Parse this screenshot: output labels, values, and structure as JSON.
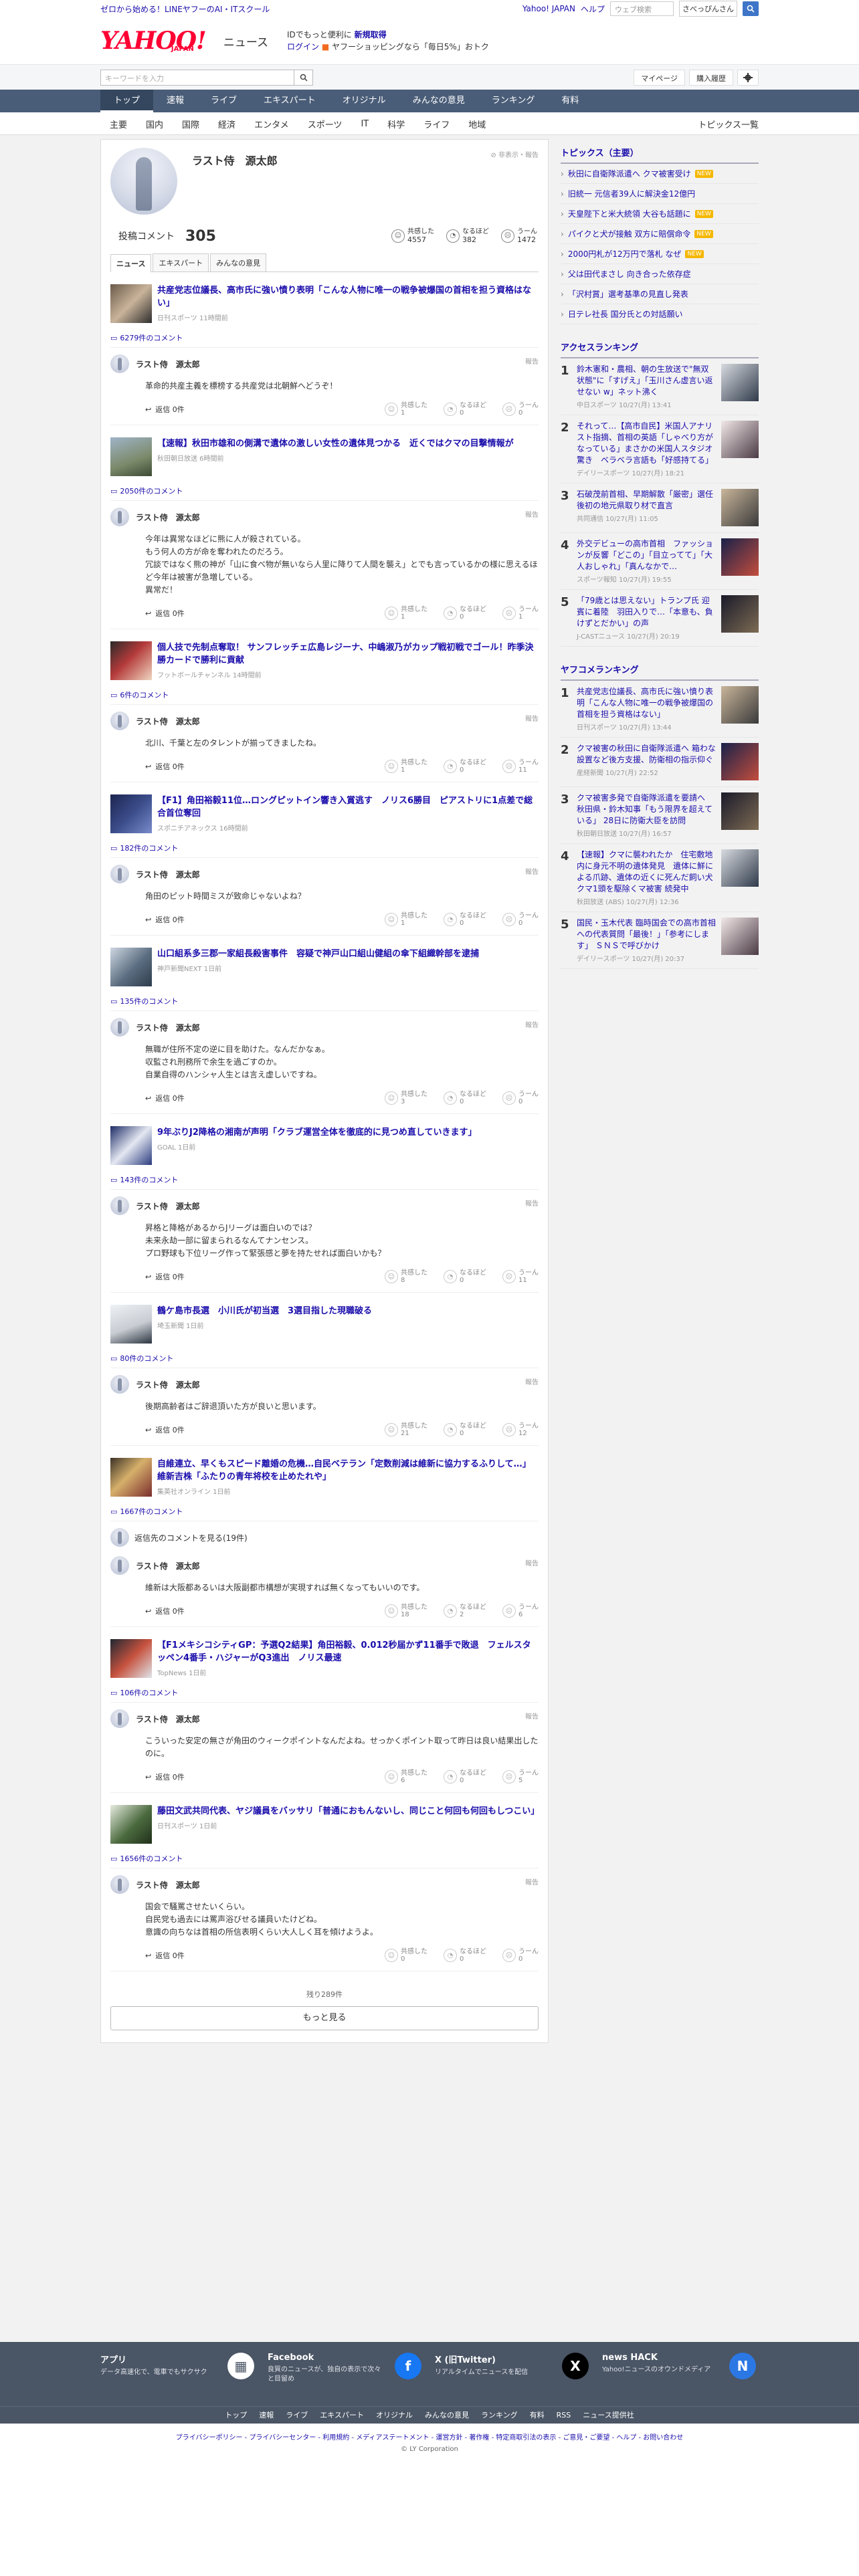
{
  "promo_bar": {
    "left": "ゼロから始める！LINEヤフーのAI・ITスクール",
    "links": [
      "Yahoo! JAPAN",
      "ヘルプ"
    ],
    "search_placeholder": "ウェブ検索",
    "user_label": "さべっぴんさん"
  },
  "header": {
    "logo_main": "YAHOO!",
    "logo_sub": "JAPAN",
    "logo_news": "ニュース",
    "promo_l1_pre": "IDでもっと便利に",
    "promo_l1_link": "新規取得",
    "promo_l2_link": "ログイン",
    "promo_l2_text": "ヤフーショッピングなら「毎日5%」おトク"
  },
  "search": {
    "placeholder": "キーワードを入力",
    "mypage": "マイページ",
    "history": "購入履歴"
  },
  "nav": [
    "トップ",
    "速報",
    "ライブ",
    "エキスパート",
    "オリジナル",
    "みんなの意見",
    "ランキング",
    "有料"
  ],
  "subnav": [
    "主要",
    "国内",
    "国際",
    "経済",
    "エンタメ",
    "スポーツ",
    "IT",
    "科学",
    "ライフ",
    "地域"
  ],
  "subnav_right": "トピックス一覧",
  "profile": {
    "name": "ラスト侍　源太郎",
    "right_text": "非表示・報告",
    "comments_label": "投稿コメント",
    "comments_count": "305",
    "reactions": [
      {
        "label": "共感した",
        "value": "4557"
      },
      {
        "label": "なるほど",
        "value": "382"
      },
      {
        "label": "うーん",
        "value": "1472"
      }
    ],
    "tabs": [
      "ニュース",
      "エキスパート",
      "みんなの意見"
    ]
  },
  "ui": {
    "report": "報告",
    "reply": "返信 0件",
    "v1": "共感した",
    "v2": "なるほど",
    "v3": "うーん"
  },
  "items": [
    {
      "title": "共産党志位議長、高市氏に強い憤り表明「こんな人物に唯一の戦争被爆国の首相を担う資格はない」",
      "source": "日刊スポーツ 11時間前",
      "comment_count": "6279件のコメント",
      "user": "ラスト侍　源太郎",
      "time": "6時間前",
      "text": [
        "革命的共産主義を標榜する共産党は北朝鮮へどうぞ！"
      ],
      "votes": [
        "1",
        "0",
        "0"
      ]
    },
    {
      "title": "【速報】秋田市雄和の側溝で遺体の激しい女性の遺体見つかる　近くではクマの目撃情報が",
      "source": "秋田朝日放送 6時間前",
      "comment_count": "2050件のコメント",
      "user": "ラスト侍　源太郎",
      "time": "6時間前",
      "text": [
        "今年は異常なほどに熊に人が殺されている。",
        "もう何人の方が命を奪われたのだろう。",
        "冗談ではなく熊の神が「山に食べ物が無いなら人里に降りて人間を襲え」とでも言っているかの様に思えるほど今年は被害が急増している。",
        "異常だ！"
      ],
      "votes": [
        "1",
        "0",
        "1"
      ]
    },
    {
      "title": "個人技で先制点奪取！ サンフレッチェ広島レジーナ、中嶋淑乃がカップ戦初戦でゴール！昨季決勝カードで勝利に貢献",
      "source": "フットボールチャンネル 14時間前",
      "comment_count": "6件のコメント",
      "user": "ラスト侍　源太郎",
      "time": "14時間前",
      "text": [
        "北川、千葉と左のタレントが揃ってきましたね。"
      ],
      "votes": [
        "1",
        "0",
        "11"
      ]
    },
    {
      "title": "【F1】角田裕毅11位…ロングピットイン響き入賞逃す　ノリス6勝目　ピアストリに1点差で総合首位奪回",
      "source": "スポニチアネックス 16時間前",
      "comment_count": "182件のコメント",
      "user": "ラスト侍　源太郎",
      "time": "16時間前",
      "text": [
        "角田のピット時間ミスが致命じゃないよね？"
      ],
      "votes": [
        "1",
        "0",
        "0"
      ]
    },
    {
      "title": "山口組系多三郡一家組長殺害事件　容疑で神戸山口組山健組の傘下組織幹部を逮捕",
      "source": "神戸新聞NEXT 1日前",
      "comment_count": "135件のコメント",
      "user": "ラスト侍　源太郎",
      "time": "16時間前",
      "text": [
        "無職が住所不定の逆に目を助けた。なんだかなぁ。",
        "収監され刑務所で余生を過ごすのか。",
        "自業自得のハンシャ人生とは言え虚しいですね。"
      ],
      "votes": [
        "3",
        "0",
        "0"
      ]
    },
    {
      "title": "9年ぶりJ2降格の湘南が声明「クラブ運営全体を徹底的に見つめ直していきます」",
      "source": "GOAL 1日前",
      "comment_count": "143件のコメント",
      "user": "ラスト侍　源太郎",
      "time": "23時間前",
      "text": [
        "昇格と降格があるからJリーグは面白いのでは？",
        "未来永劫一部に留まられるなんてナンセンス。",
        "プロ野球も下位リーグ作って緊張感と夢を持たせれば面白いかも？"
      ],
      "votes": [
        "8",
        "0",
        "11"
      ]
    },
    {
      "title": "鶴ケ島市長選　小川氏が初当選　3選目指した現職破る",
      "source": "埼玉新聞 1日前",
      "comment_count": "80件のコメント",
      "user": "ラスト侍　源太郎",
      "time": "23時間前",
      "text": [
        "後期高齢者はご辞退頂いた方が良いと思います。"
      ],
      "votes": [
        "21",
        "0",
        "12"
      ]
    },
    {
      "title": "自維連立、早くもスピード離婚の危機…自民ベテラン「定数削減は維新に協力するふりして…」維新吉株「ふたりの青年将校を止めたれや」",
      "source": "集英社オンライン 1日前",
      "comment_count": "1667件のコメント",
      "replies_link": "返信先のコメントを見る(19件)",
      "user": "ラスト侍　源太郎",
      "time": "1日前",
      "text": [
        "維新は大阪都あるいは大阪副都市構想が実現すれば無くなってもいいのです。"
      ],
      "votes": [
        "18",
        "2",
        "6"
      ]
    },
    {
      "title": "【F1メキシコシティGP：予選Q2結果】角田裕毅、0.012秒届かず11番手で敗退　フェルスタッペン4番手・ハジャーがQ3進出　ノリス最速",
      "source": "TopNews 1日前",
      "comment_count": "106件のコメント",
      "user": "ラスト侍　源太郎",
      "time": "1日前",
      "text": [
        "こういった安定の無さが角田のウィークポイントなんだよね。せっかくポイント取って昨日は良い結果出したのに。"
      ],
      "votes": [
        "6",
        "0",
        "5"
      ]
    },
    {
      "title": "藤田文武共同代表、ヤジ議員をバッサリ「普通におもんないし、同じこと何回も何回もしつこい」",
      "source": "日刊スポーツ 1日前",
      "comment_count": "1656件のコメント",
      "user": "ラスト侍　源太郎",
      "time": "1日前",
      "text": [
        "国会で騒罵させたいくらい。",
        "自民党も過去には罵声浴びせる議員いたけどね。",
        "意識の向ちなは首相の所信表明くらい大人しく耳を傾けようよ。"
      ],
      "votes": [
        "0",
        "0",
        "0"
      ]
    }
  ],
  "more": {
    "remaining": "残り289件",
    "button": "もっと見る"
  },
  "topics": {
    "title": "トピックス（主要）",
    "items": [
      {
        "text": "秋田に自衛隊派遣へ クマ被害受け",
        "new": true
      },
      {
        "text": "旧統一 元信者39人に解決金12億円",
        "new": false
      },
      {
        "text": "天皇陛下と米大統領 大谷も話題に",
        "new": true
      },
      {
        "text": "パイクと犬が接触 双方に賠償命令",
        "new": true
      },
      {
        "text": "2000円札が12万円で落札 なぜ",
        "new": true
      },
      {
        "text": "父は田代まさし 向き合った依存症",
        "new": false
      },
      {
        "text": "「沢村賞」選考基準の見直し発表",
        "new": false
      },
      {
        "text": "日テレ社長 国分氏との対話願い",
        "new": false
      }
    ],
    "new_label": "NEW"
  },
  "access_ranking": {
    "title": "アクセスランキング",
    "items": [
      {
        "n": "1",
        "title": "鈴木憲和・農相、朝の生放送で\"無双状態\"に「すげえ」「玉川さん虚言い返せない w」ネット沸く",
        "src": "中日スポーツ 10/27(月) 13:41"
      },
      {
        "n": "2",
        "title": "それって…【高市自民】米国人アナリスト指摘、首相の英語「しゃべり方がなっている」まさかの米国人スタジオ驚き　ベラベラ言語も「好感持てる」",
        "src": "デイリースポーツ 10/27(月) 18:21"
      },
      {
        "n": "3",
        "title": "石破茂前首相、早期解散「厳密」選任後初の地元県取り材で直言",
        "src": "共同通信 10/27(月) 11:05"
      },
      {
        "n": "4",
        "title": "外交デビューの高市首相　ファッションが反響「どこの」「目立ってて」「大人おしゃれ」「真んなかで…",
        "src": "スポーツ報知 10/27(月) 19:55"
      },
      {
        "n": "5",
        "title": "「79歳とは思えない」トランプ氏 迎賓に着陸　羽田入りで…「本意も、負けずとだかい」の声",
        "src": "J-CASTニュース 10/27(月) 20:19"
      }
    ]
  },
  "yahoo_ranking": {
    "title": "ヤフコメランキング",
    "items": [
      {
        "n": "1",
        "title": "共産党志位議長、高市氏に強い憤り表明「こんな人物に唯一の戦争被爆国の首相を担う資格はない」",
        "src": "日刊スポーツ 10/27(月) 13:44"
      },
      {
        "n": "2",
        "title": "クマ被害の秋田に自衛隊派遣へ 箱わな設置など後方支援、防衛相の指示仰ぐ",
        "src": "産経新聞 10/27(月) 22:52"
      },
      {
        "n": "3",
        "title": "クマ被害多発で自衛隊派遣を要請へ　秋田県・鈴木知事「もう限界を超えている」 28日に防衛大臣を訪問",
        "src": "秋田朝日放送 10/27(月) 16:57"
      },
      {
        "n": "4",
        "title": "【速報】クマに襲われたか　住宅敷地内に身元不明の遺体発見　遺体に鮮による爪跡、遺体の近くに死んだ飼い犬　クマ1頭を駆除くマ被害 続発中",
        "src": "秋田放送 (ABS) 10/27(月) 12:36"
      },
      {
        "n": "5",
        "title": "国民・玉木代表 臨時国会での高市首相への代表質問「最後！」「参考にします」 ＳＮＳで呼びかけ",
        "src": "デイリースポーツ 10/27(月) 20:37"
      }
    ]
  },
  "footer": {
    "cards": [
      {
        "t": "アプリ",
        "d": "データ高速化で、電車でもサクサク"
      },
      {
        "t": "Facebook",
        "d": "良質のニュースが、独自の表示で次々と目留め"
      },
      {
        "t": "X (旧Twitter)",
        "d": "リアルタイムでニュースを配信"
      },
      {
        "t": "news HACK",
        "d": "Yahoo!ニュースのオウンドメディア"
      }
    ],
    "nav": [
      "トップ",
      "速報",
      "ライブ",
      "エキスパート",
      "オリジナル",
      "みんなの意見",
      "ランキング",
      "有料",
      "RSS",
      "ニュース提供社"
    ],
    "links": "プライバシーポリシー - プライバシーセンター - 利用規約 - メディアステートメント - 運営方針 - 著作権 - 特定商取引法の表示 - ご意見・ご要望 - ヘルプ - お問い合わせ",
    "copyright": "© LY Corporation"
  },
  "colors": {
    "link": "#1a0dab",
    "nav": "#4a5d78",
    "brand": "#ff0033",
    "new_badge": "#f5b700"
  }
}
